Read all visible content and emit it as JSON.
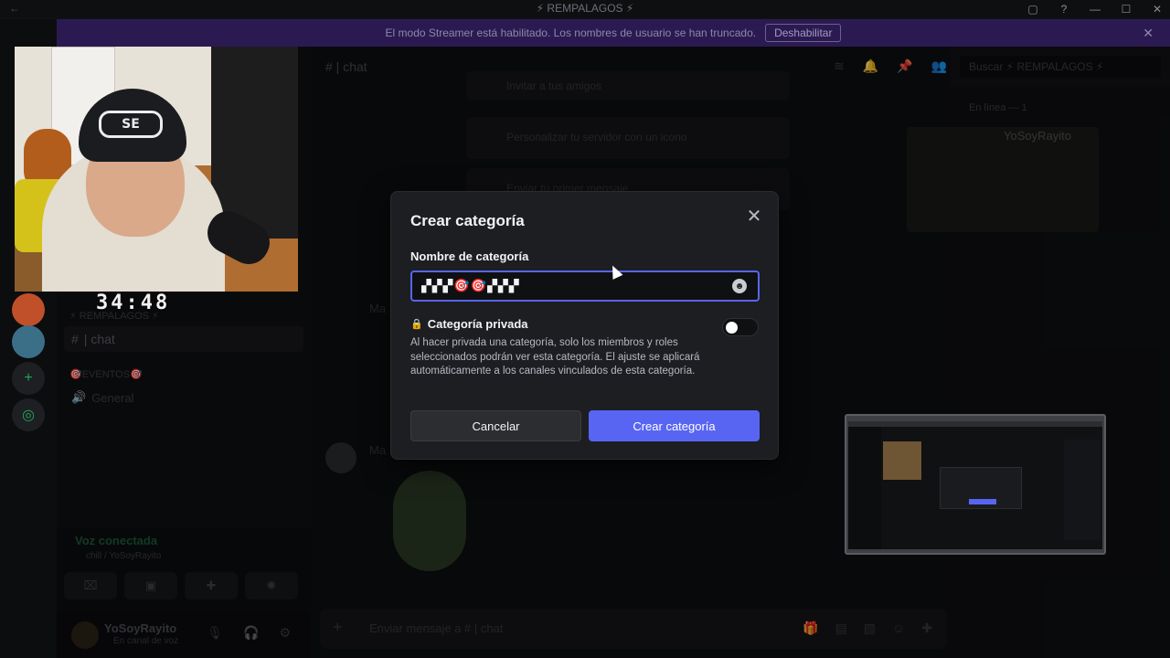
{
  "window": {
    "title": "⚡ REMPALAGOS ⚡",
    "back_arrow": "←",
    "controls": [
      "▢",
      "?",
      "—",
      "☐",
      "✕"
    ]
  },
  "banner": {
    "text": "El modo Streamer está habilitado. Los nombres de usuario se han truncado.",
    "button": "Deshabilitar",
    "close": "✕"
  },
  "webcam": {
    "cap_text": "SE",
    "timer": "34:48"
  },
  "sidebar": {
    "category1": "⚡ REMPALAGOS ⚡",
    "channel": "| chat",
    "category2": "🎯EVENTOS🎯",
    "voice_channel": "General",
    "voice_status": "Voz conectada",
    "voice_sub": "chill / YoSoyRayito",
    "user_name": "YoSoyRayito",
    "user_status": "En canal de voz"
  },
  "chat": {
    "header_channel": "# | chat",
    "search_placeholder": "Buscar ⚡ REMPALAGOS ⚡",
    "card1": "Invitar a tus amigos",
    "card2": "Personalizar tu servidor con un icono",
    "card3": "Enviar tu primer mensaje",
    "message_placeholder": "Enviar mensaje a # | chat",
    "author1": "Ma",
    "author2": "Ma"
  },
  "members": {
    "header": "En línea — 1",
    "member_name": "YoSoyRayito"
  },
  "modal": {
    "title": "Crear categoría",
    "name_label": "Nombre de categoría",
    "name_value": "▞▞▞🎯🎯▞▞▞",
    "private_label": "Categoría privada",
    "private_enabled": false,
    "description": "Al hacer privada una categoría, solo los miembros y roles seleccionados podrán ver esta categoría. El ajuste se aplicará automáticamente a los canales vinculados de esta categoría.",
    "cancel_label": "Cancelar",
    "create_label": "Crear categoría",
    "accent_color": "#5865f2"
  }
}
